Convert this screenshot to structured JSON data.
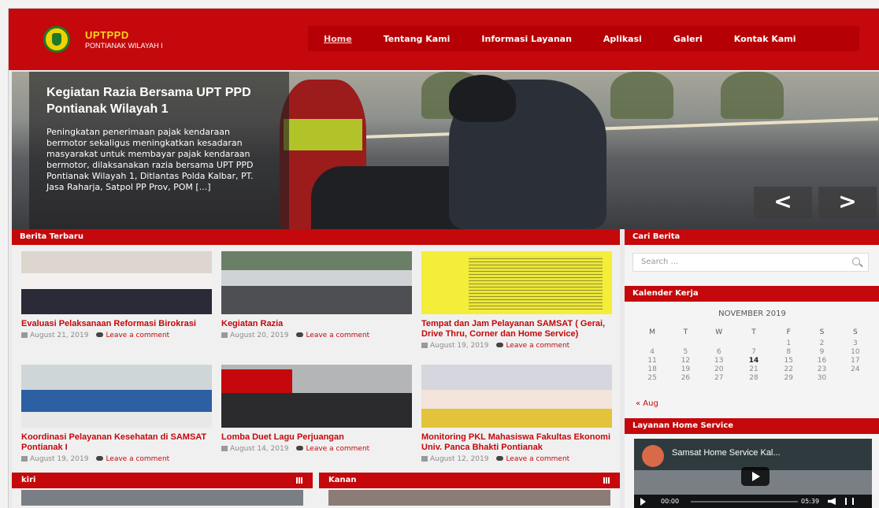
{
  "brand": {
    "title": "UPTPPD",
    "subtitle": "PONTIANAK WILAYAH I"
  },
  "nav": [
    {
      "label": "Home",
      "active": true
    },
    {
      "label": "Tentang Kami"
    },
    {
      "label": "Informasi Layanan"
    },
    {
      "label": "Aplikasi"
    },
    {
      "label": "Galeri"
    },
    {
      "label": "Kontak Kami"
    }
  ],
  "slider": {
    "title": "Kegiatan Razia Bersama UPT PPD Pontianak Wilayah 1",
    "text": "Peningkatan penerimaan pajak kendaraan bermotor sekaligus meningkatkan kesadaran masyarakat untuk membayar pajak kendaraan bermotor, dilaksanakan razia bersama UPT PPD Pontianak Wilayah 1, Ditlantas Polda Kalbar, PT. Jasa Raharja, Satpol PP Prov, POM [...]",
    "prev": "<",
    "next": ">"
  },
  "berita": {
    "heading": "Berita Terbaru",
    "comment_label": "Leave a comment",
    "posts": [
      {
        "title": "Evaluasi Pelaksanaan Reformasi Birokrasi",
        "date": "August 21, 2019"
      },
      {
        "title": "Kegiatan Razia",
        "date": "August 20, 2019"
      },
      {
        "title": "Tempat dan Jam Pelayanan SAMSAT ( Gerai, Drive Thru, Corner dan Home Service)",
        "date": "August 19, 2019"
      },
      {
        "title": "Koordinasi Pelayanan Kesehatan di SAMSAT Pontianak I",
        "date": "August 19, 2019"
      },
      {
        "title": "Lomba Duet Lagu Perjuangan",
        "date": "August 14, 2019"
      },
      {
        "title": "Monitoring PKL Mahasiswa Fakultas Ekonomi Univ. Panca Bhakti Pontianak",
        "date": "August 12, 2019"
      }
    ]
  },
  "sections": {
    "kiri": "kiri",
    "kanan": "Kanan"
  },
  "sidebar": {
    "search_heading": "Cari Berita",
    "search_placeholder": "Search ...",
    "calendar_heading": "Kalender Kerja",
    "calendar_caption": "NOVEMBER 2019",
    "weekdays": [
      "M",
      "T",
      "W",
      "T",
      "F",
      "S",
      "S"
    ],
    "weeks": [
      [
        "",
        "",
        "",
        "",
        "1",
        "2",
        "3"
      ],
      [
        "4",
        "5",
        "6",
        "7",
        "8",
        "9",
        "10"
      ],
      [
        "11",
        "12",
        "13",
        "14",
        "15",
        "16",
        "17"
      ],
      [
        "18",
        "19",
        "20",
        "21",
        "22",
        "23",
        "24"
      ],
      [
        "25",
        "26",
        "27",
        "28",
        "29",
        "30",
        ""
      ]
    ],
    "today": "14",
    "prev_month": "« Aug",
    "video_heading": "Layanan Home Service",
    "video_title": "Samsat Home Service Kal...",
    "video_time_current": "00:00",
    "video_time_total": "05:39"
  },
  "colors": {
    "brand_red": "#c4080b",
    "brand_yellow": "#ffd21c"
  }
}
